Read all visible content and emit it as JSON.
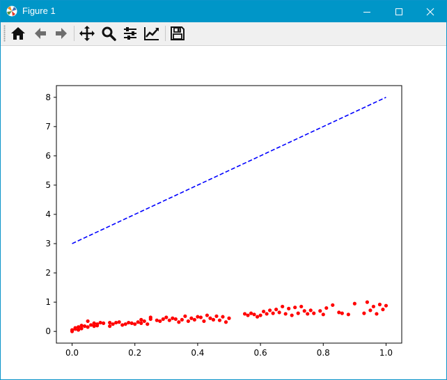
{
  "window": {
    "title": "Figure 1"
  },
  "toolbar": {
    "tools": [
      "home-icon",
      "back-arrow-icon",
      "forward-arrow-icon",
      "pan-icon",
      "zoom-icon",
      "subplots-icon",
      "edit-curves-icon",
      "save-icon"
    ]
  },
  "colors": {
    "titlebar": "#0096c8",
    "line": "#0000ff",
    "points": "#ff0000"
  },
  "chart_data": {
    "type": "scatter",
    "title": "",
    "xlabel": "",
    "ylabel": "",
    "xlim": [
      -0.05,
      1.05
    ],
    "ylim": [
      -0.4,
      8.4
    ],
    "xticks": [
      "0.0",
      "0.2",
      "0.4",
      "0.6",
      "0.8",
      "1.0"
    ],
    "yticks": [
      "0",
      "1",
      "2",
      "3",
      "4",
      "5",
      "6",
      "7",
      "8"
    ],
    "grid": false,
    "series": [
      {
        "style": "dashed-line",
        "color": "#0000ff",
        "x": [
          0.0,
          1.0
        ],
        "y": [
          3.0,
          8.0
        ]
      },
      {
        "style": "points",
        "color": "#ff0000",
        "x": [
          0.0,
          0.0,
          0.01,
          0.01,
          0.02,
          0.02,
          0.03,
          0.03,
          0.04,
          0.05,
          0.05,
          0.06,
          0.07,
          0.07,
          0.08,
          0.08,
          0.09,
          0.1,
          0.12,
          0.12,
          0.13,
          0.14,
          0.15,
          0.16,
          0.17,
          0.18,
          0.19,
          0.2,
          0.21,
          0.22,
          0.22,
          0.23,
          0.24,
          0.25,
          0.25,
          0.27,
          0.28,
          0.29,
          0.3,
          0.31,
          0.32,
          0.33,
          0.34,
          0.35,
          0.36,
          0.37,
          0.38,
          0.39,
          0.4,
          0.41,
          0.42,
          0.43,
          0.44,
          0.45,
          0.46,
          0.47,
          0.48,
          0.49,
          0.5,
          0.55,
          0.56,
          0.57,
          0.58,
          0.59,
          0.6,
          0.61,
          0.62,
          0.63,
          0.64,
          0.65,
          0.66,
          0.67,
          0.68,
          0.69,
          0.7,
          0.71,
          0.72,
          0.73,
          0.74,
          0.75,
          0.76,
          0.77,
          0.79,
          0.8,
          0.81,
          0.83,
          0.85,
          0.86,
          0.88,
          0.9,
          0.93,
          0.94,
          0.95,
          0.96,
          0.97,
          0.98,
          0.99,
          1.0
        ],
        "y": [
          0.0,
          0.05,
          0.08,
          0.12,
          0.05,
          0.15,
          0.1,
          0.2,
          0.18,
          0.15,
          0.35,
          0.22,
          0.18,
          0.28,
          0.25,
          0.2,
          0.3,
          0.28,
          0.18,
          0.3,
          0.25,
          0.3,
          0.32,
          0.22,
          0.25,
          0.3,
          0.28,
          0.25,
          0.32,
          0.4,
          0.28,
          0.35,
          0.25,
          0.42,
          0.48,
          0.38,
          0.35,
          0.42,
          0.48,
          0.38,
          0.45,
          0.42,
          0.32,
          0.4,
          0.52,
          0.35,
          0.45,
          0.4,
          0.5,
          0.48,
          0.35,
          0.55,
          0.45,
          0.4,
          0.52,
          0.38,
          0.5,
          0.32,
          0.45,
          0.6,
          0.55,
          0.62,
          0.58,
          0.5,
          0.55,
          0.68,
          0.6,
          0.72,
          0.62,
          0.75,
          0.65,
          0.85,
          0.6,
          0.78,
          0.55,
          0.82,
          0.62,
          0.85,
          0.7,
          0.6,
          0.72,
          0.62,
          0.7,
          0.58,
          0.8,
          0.9,
          0.65,
          0.62,
          0.58,
          0.95,
          0.62,
          1.0,
          0.72,
          0.85,
          0.6,
          0.92,
          0.75,
          0.88
        ]
      }
    ]
  }
}
